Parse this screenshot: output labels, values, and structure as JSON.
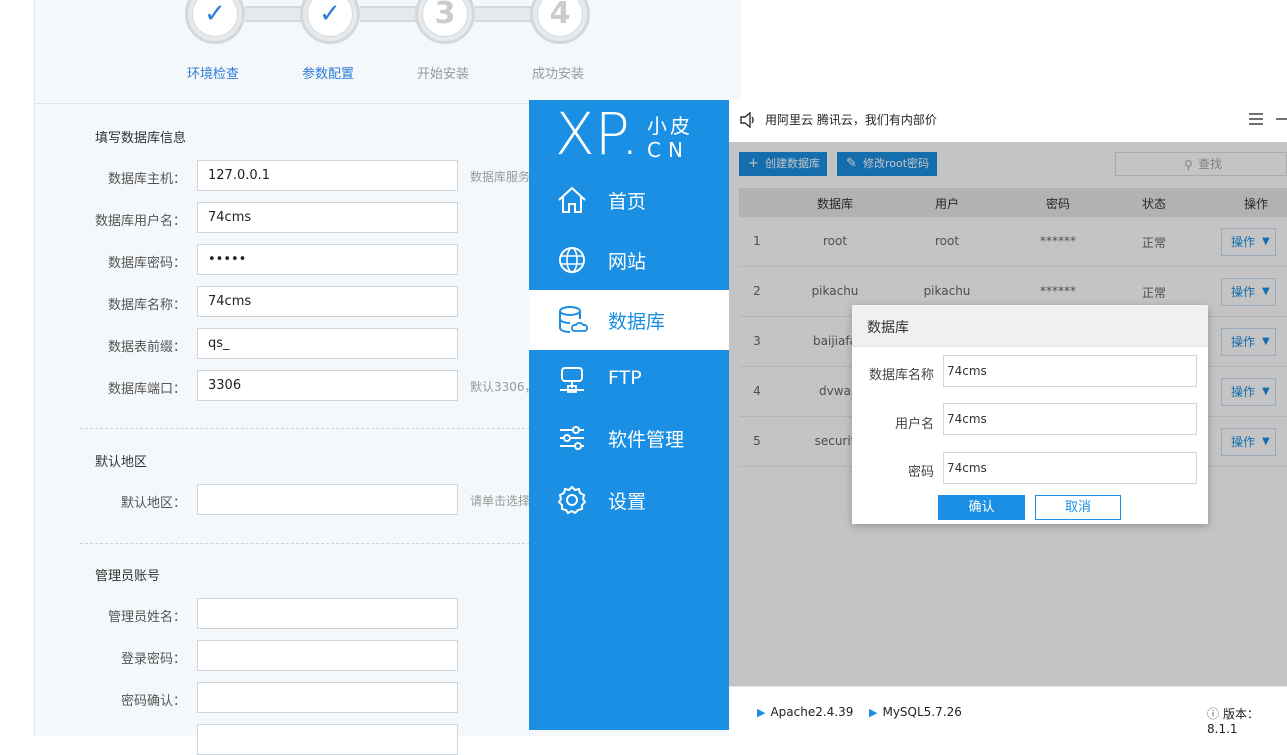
{
  "installer": {
    "steps": [
      {
        "label": "环境检查",
        "mark": "✓",
        "done": true
      },
      {
        "label": "参数配置",
        "mark": "✓",
        "done": true
      },
      {
        "label": "开始安装",
        "mark": "3",
        "done": false
      },
      {
        "label": "成功安装",
        "mark": "4",
        "done": false
      }
    ],
    "db_section_title": "填写数据库信息",
    "fields": {
      "db_host": {
        "label": "数据库主机：",
        "value": "127.0.0.1",
        "hint": "数据库服务"
      },
      "db_user": {
        "label": "数据库用户名：",
        "value": "74cms"
      },
      "db_password": {
        "label": "数据库密码：",
        "value": "•••••"
      },
      "db_name": {
        "label": "数据库名称：",
        "value": "74cms"
      },
      "db_prefix": {
        "label": "数据表前缀：",
        "value": "qs_"
      },
      "db_port": {
        "label": "数据库端口：",
        "value": "3306",
        "hint": "默认3306，"
      }
    },
    "region_section_title": "默认地区",
    "region": {
      "label": "默认地区：",
      "value": "",
      "hint": "请单击选择"
    },
    "admin_section_title": "管理员账号",
    "admin": {
      "name_label": "管理员姓名：",
      "password_label": "登录密码：",
      "confirm_label": "密码确认："
    }
  },
  "app": {
    "logo": {
      "xp": "XP.",
      "small_top": "小皮",
      "small_bottom": "CN"
    },
    "nav": [
      {
        "label": "首页",
        "icon": "home-icon"
      },
      {
        "label": "网站",
        "icon": "globe-icon"
      },
      {
        "label": "数据库",
        "icon": "database-icon",
        "active": true
      },
      {
        "label": "FTP",
        "icon": "ftp-server-icon"
      },
      {
        "label": "软件管理",
        "icon": "sliders-icon"
      },
      {
        "label": "设置",
        "icon": "gear-icon"
      }
    ],
    "notice": "用阿里云 腾讯云，我们有内部价",
    "toolbar": {
      "create_db": "创建数据库",
      "change_root": "修改root密码",
      "search_placeholder": "查找"
    },
    "table": {
      "headers": [
        "数据库",
        "用户",
        "密码",
        "状态",
        "操作"
      ],
      "rows": [
        {
          "no": "1",
          "db": "root",
          "user": "root",
          "pwd": "******",
          "status": "正常",
          "op": "操作"
        },
        {
          "no": "2",
          "db": "pikachu",
          "user": "pikachu",
          "pwd": "******",
          "status": "正常",
          "op": "操作"
        },
        {
          "no": "3",
          "db": "baijiafa",
          "user": "",
          "pwd": "",
          "status": "",
          "op": "操作"
        },
        {
          "no": "4",
          "db": "dvwa",
          "user": "",
          "pwd": "",
          "status": "",
          "op": "操作"
        },
        {
          "no": "5",
          "db": "securit",
          "user": "",
          "pwd": "",
          "status": "",
          "op": "操作"
        }
      ]
    },
    "status": {
      "apache": "Apache2.4.39",
      "mysql": "MySQL5.7.26",
      "version": "版本：8.1.1"
    }
  },
  "dialog": {
    "title": "数据库",
    "db_name_label": "数据库名称",
    "db_name_value": "74cms",
    "user_label": "用户名",
    "user_value": "74cms",
    "password_label": "密码",
    "password_value": "74cms",
    "ok": "确认",
    "cancel": "取消"
  },
  "colors": {
    "brand": "#1a8fe3",
    "step_done": "#2f7bd6"
  }
}
